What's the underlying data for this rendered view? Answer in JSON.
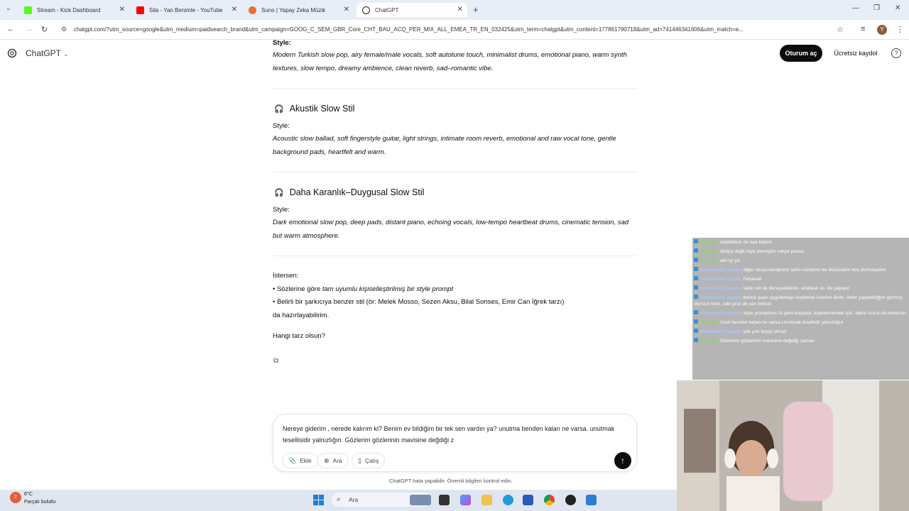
{
  "browser": {
    "tabs": [
      {
        "title": "Stream - Kick Dashboard",
        "color": "#53fc18"
      },
      {
        "title": "Sila - Yan Benimle - YouTube",
        "color": "#ff0000"
      },
      {
        "title": "Suno | Yapay Zeka Müzik",
        "color": "#f26b3a"
      },
      {
        "title": "ChatGPT",
        "color": "#222222"
      }
    ],
    "url": "chatgpt.com/?utm_source=google&utm_medium=paidsearch_brand&utm_campaign=GOOG_C_SEM_GBR_Core_CHT_BAU_ACQ_PER_MIX_ALL_EMEA_TR_EN_032425&utm_term=chatgpt&utm_content=177861790718&utm_ad=741446341606&utm_match=e...",
    "profile_initial": "Y"
  },
  "header": {
    "brand": "ChatGPT",
    "login": "Oturum aç",
    "signup": "Ücretsiz kaydol",
    "help": "?"
  },
  "conversation": {
    "style1_label": "Style:",
    "style1_text": "Modern Turkish slow pop, airy female/male vocals, soft autotune touch, minimalist drums, emotional piano, warm synth textures, slow tempo, dreamy ambience, clean reverb, sad–romantic vibe.",
    "section2_title": "Akustik Slow Stil",
    "style2_label": "Style:",
    "style2_text": "Acoustic slow ballad, soft fingerstyle guitar, light strings, intimate room reverb, emotional and raw vocal tone, gentle background pads, heartfelt and warm.",
    "section3_title": "Daha Karanlık–Duygusal Slow Stil",
    "style3_label": "Style:",
    "style3_text": "Dark emotional slow pop, deep pads, distant piano, echoing vocals, low-tempo heartbeat drums, cinematic tension, sad but warm atmosphere.",
    "offer_intro": "İstersen:",
    "offer_item1_prefix": "• Sözlerine göre ",
    "offer_item1_italic": "tam uyumlu kişiselleştirilmiş bir style prompt",
    "offer_item2": "• Belirli bir şarkıcıya benzer stil (ör: Melek Mosso, Sezen Aksu, Bilal Sonses, Emir Can İğrek tarzı)",
    "offer_item2_cont": "da hazırlayabilirim.",
    "question": "Hangi tarz olsun?"
  },
  "composer": {
    "text": "Nereye giderim , nerede kalırım ki? Benim ev bildiğim bir tek sen vardın ya? unutma benden kalan ne varsa. unutmak tesellisidir yalnızlığın. Gözlerim gözlerinin mavisine değdiği z",
    "attach": "Ekle",
    "search": "Ara",
    "study": "Çalış"
  },
  "disclaimer": "ChatGPT hata yapabilir. Önemli bilgileri kontrol edin.",
  "stream_chat": [
    {
      "user": "Payxho",
      "user_color": "#7fe05a",
      "msg": ": üsteklilere de bak bakim"
    },
    {
      "user": "Payxho",
      "user_color": "#7fe05a",
      "msg": ": dünya değil rüya demiştim varya puuuu"
    },
    {
      "user": "Payxho",
      "user_color": "#7fe05a",
      "msg": ": alki iyi ya"
    },
    {
      "user": "Abdulkadir yapak",
      "user_color": "#a9c7ff",
      "msg": ": diğer oluşturacağımız şarkı sözlerini de düşünelim boş durmayalım"
    },
    {
      "user": "Abdulkadir yapak",
      "user_color": "#a9c7ff",
      "msg": ": Fenasall"
    },
    {
      "user": "Abdulkadir yapak",
      "user_color": "#a9c7ff",
      "msg": ": farklı stil de deneyebilirsin, arabesk vs. de yapıyor"
    },
    {
      "user": "Abdulkadir yapak",
      "user_color": "#a9c7ff",
      "msg": ": bence şuan uygulamayı keşfetme üzerine ilerle. neler yapabildiğini görmüş olursun hem. tabi yine de sen bilirsin"
    },
    {
      "user": "Abdulkadir yapak",
      "user_color": "#a9c7ff",
      "msg": ": style promptunu bi yere kopyala. kaybetmemek için. daha sonra da denersin"
    },
    {
      "user": "Payxho",
      "user_color": "#7fe05a",
      "msg": ": Unut benden kalan ne varsa Unutmak tesellidir yalnızlığın"
    },
    {
      "user": "Abdulkadir yapak",
      "user_color": "#a9c7ff",
      "msg": ": yok yok bişey olmaz"
    },
    {
      "user": "Payxho",
      "user_color": "#7fe05a",
      "msg": ": Gözlerim gözlerinin mavisine değdiği zaman"
    }
  ],
  "taskbar": {
    "weather_temp": "8°C",
    "weather_text": "Parçalı bulutlu",
    "weather_badge": "2",
    "search": "Ara"
  }
}
